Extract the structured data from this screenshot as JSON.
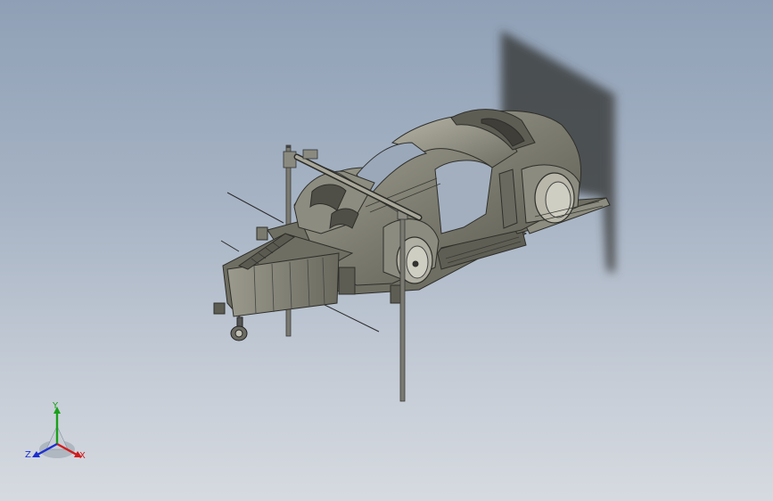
{
  "viewport": {
    "description_free": true
  },
  "triad": {
    "x_label": "X",
    "y_label": "Y",
    "z_label": "Z",
    "colors": {
      "x": "#d11c1c",
      "y": "#1aa01a",
      "z": "#1c2fd1"
    }
  }
}
